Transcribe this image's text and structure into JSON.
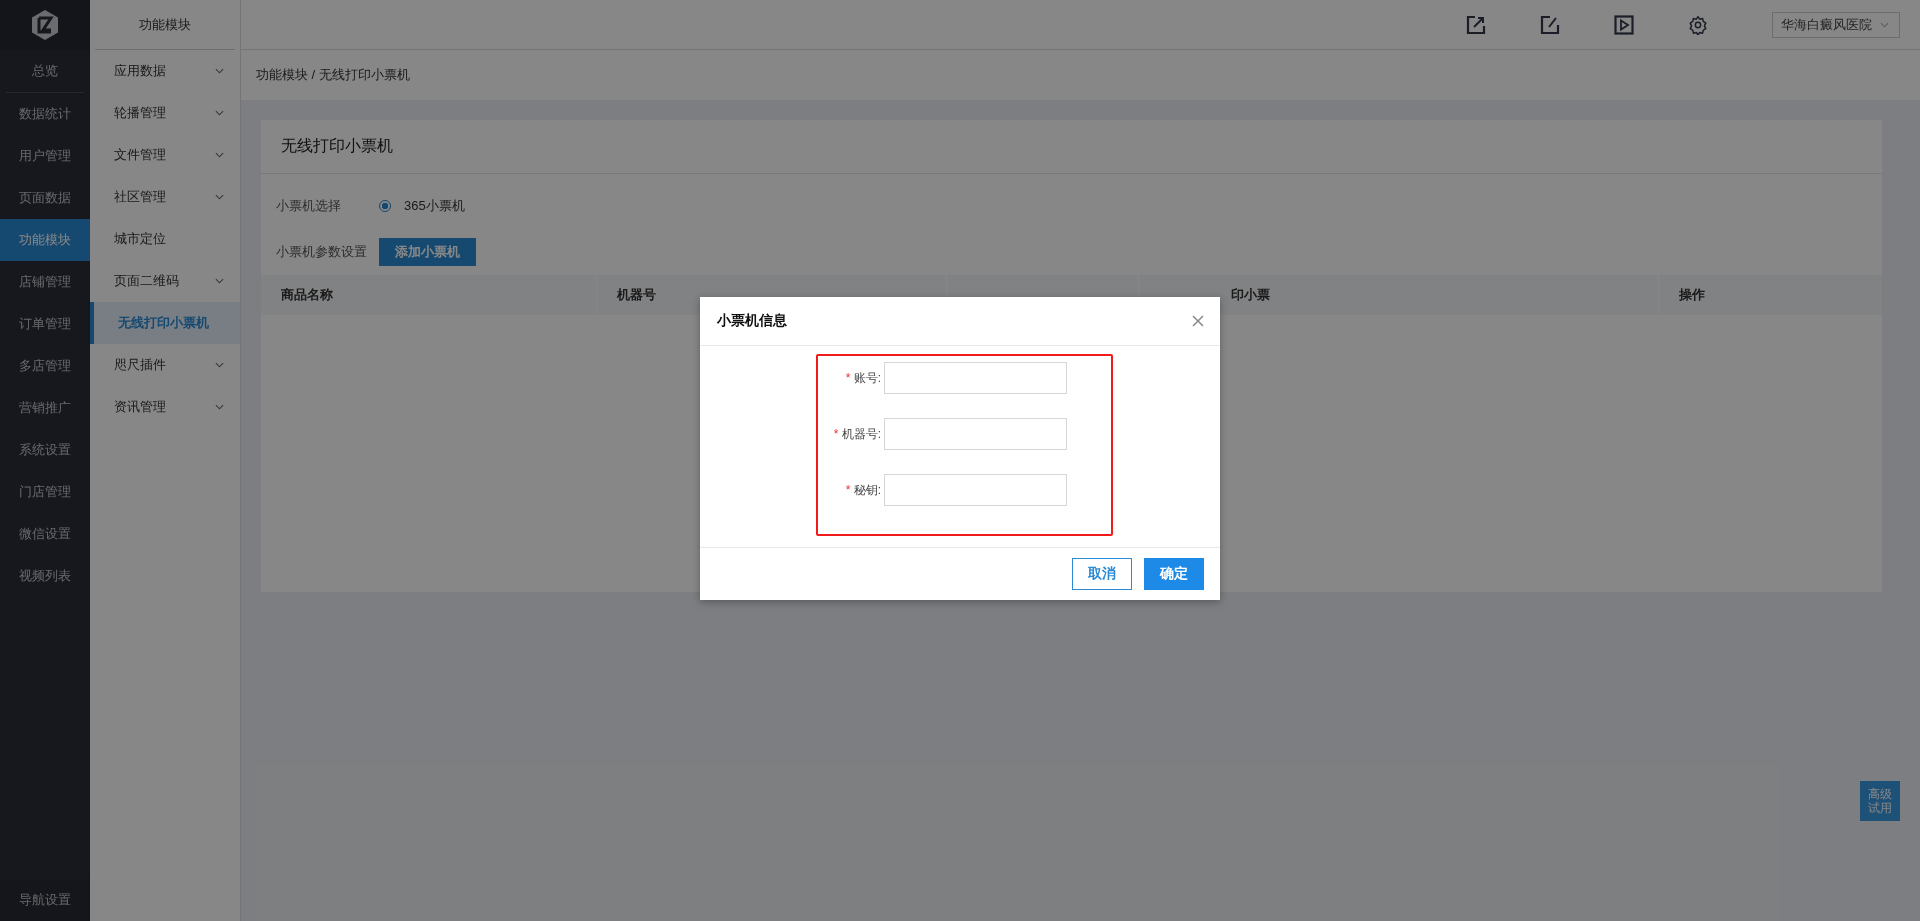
{
  "nav": {
    "items": [
      {
        "label": "总览",
        "selected": false
      },
      {
        "label": "数据统计",
        "selected": false
      },
      {
        "label": "用户管理",
        "selected": false
      },
      {
        "label": "页面数据",
        "selected": false
      },
      {
        "label": "功能模块",
        "selected": true
      },
      {
        "label": "店铺管理",
        "selected": false
      },
      {
        "label": "订单管理",
        "selected": false
      },
      {
        "label": "多店管理",
        "selected": false
      },
      {
        "label": "营销推广",
        "selected": false
      },
      {
        "label": "系统设置",
        "selected": false
      },
      {
        "label": "门店管理",
        "selected": false
      },
      {
        "label": "微信设置",
        "selected": false
      },
      {
        "label": "视频列表",
        "selected": false
      }
    ],
    "footer": "导航设置"
  },
  "submenu": {
    "title": "功能模块",
    "items": [
      {
        "label": "应用数据",
        "expandable": true,
        "selected": false
      },
      {
        "label": "轮播管理",
        "expandable": true,
        "selected": false
      },
      {
        "label": "文件管理",
        "expandable": true,
        "selected": false
      },
      {
        "label": "社区管理",
        "expandable": true,
        "selected": false
      },
      {
        "label": "城市定位",
        "expandable": false,
        "selected": false
      },
      {
        "label": "页面二维码",
        "expandable": true,
        "selected": false
      },
      {
        "label": "无线打印小票机",
        "expandable": false,
        "selected": true
      },
      {
        "label": "咫尺插件",
        "expandable": true,
        "selected": false
      },
      {
        "label": "资讯管理",
        "expandable": true,
        "selected": false
      }
    ]
  },
  "topbar": {
    "hospital_select": "华海白癜风医院"
  },
  "breadcrumb": "功能模块 / 无线打印小票机",
  "card": {
    "title": "无线打印小票机",
    "printer_select": {
      "label": "小票机选择",
      "options": [
        {
          "label": "365小票机",
          "selected": true
        }
      ]
    },
    "params": {
      "label": "小票机参数设置",
      "button": "添加小票机"
    },
    "table": {
      "columns": [
        "商品名称",
        "机器号",
        "印小票",
        "操作"
      ]
    }
  },
  "trial_badge": "高级试用",
  "modal": {
    "title": "小票机信息",
    "fields": [
      {
        "mark": "*",
        "label": "账号:"
      },
      {
        "mark": "*",
        "label": "机器号:"
      },
      {
        "mark": "*",
        "label": "秘钥:"
      }
    ],
    "cancel": "取消",
    "confirm": "确定"
  }
}
